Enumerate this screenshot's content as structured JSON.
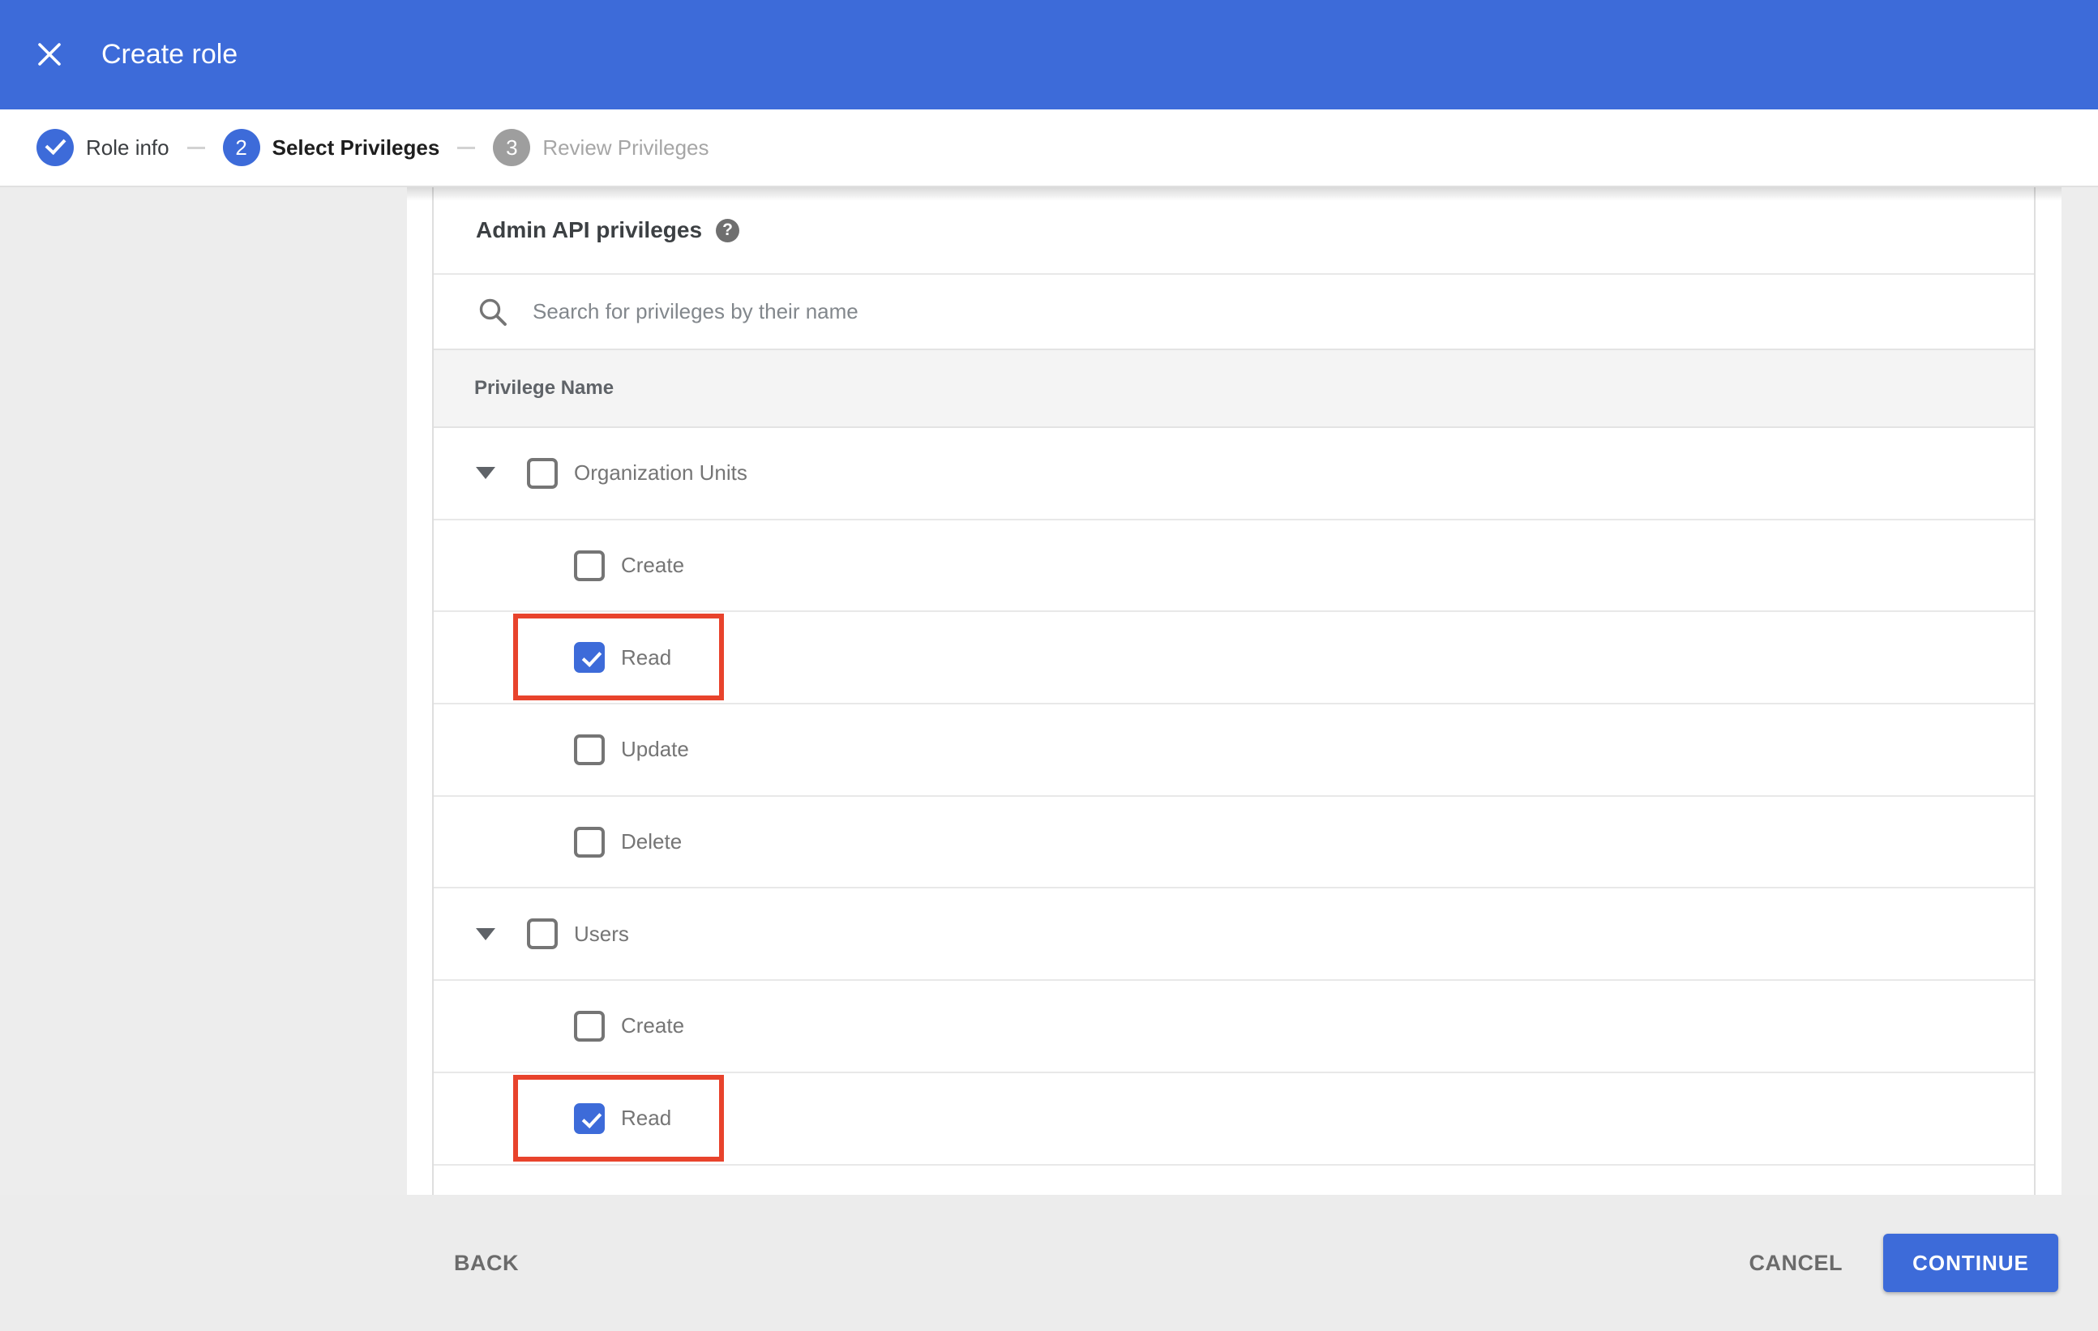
{
  "app": {
    "title": "Create role"
  },
  "colors": {
    "appbar_blue": "#3D6BD9",
    "accent_blue": "#3D6BD9",
    "annotation_red": "#E8432C",
    "inactive_step_gray": "#9E9E9E",
    "footer_gray": "#ECECEC",
    "side_gray": "#EDEDED",
    "header_row_gray": "#F4F4F4"
  },
  "icons": {
    "close": "close-x",
    "help_glyph": "?",
    "search": "magnifier",
    "expand": "triangle-down",
    "step_complete": "check"
  },
  "stepper": {
    "divider": "",
    "steps": [
      {
        "label": "Role info",
        "state": "completed"
      },
      {
        "number": "2",
        "label": "Select Privileges",
        "state": "active"
      },
      {
        "number": "3",
        "label": "Review Privileges",
        "state": "upcoming"
      }
    ]
  },
  "privileges": {
    "section_title": "Admin API privileges",
    "search_placeholder": "Search for privileges by their name",
    "column_header": "Privilege Name",
    "rows": [
      {
        "label": "Organization Units",
        "level": 0,
        "parent": true,
        "expanded": true,
        "checked": false,
        "highlighted": false
      },
      {
        "label": "Create",
        "level": 1,
        "parent": false,
        "checked": false,
        "highlighted": false
      },
      {
        "label": "Read",
        "level": 1,
        "parent": false,
        "checked": true,
        "highlighted": true
      },
      {
        "label": "Update",
        "level": 1,
        "parent": false,
        "checked": false,
        "highlighted": false
      },
      {
        "label": "Delete",
        "level": 1,
        "parent": false,
        "checked": false,
        "highlighted": false
      },
      {
        "label": "Users",
        "level": 0,
        "parent": true,
        "expanded": true,
        "checked": false,
        "highlighted": false
      },
      {
        "label": "Create",
        "level": 1,
        "parent": false,
        "checked": false,
        "highlighted": false
      },
      {
        "label": "Read",
        "level": 1,
        "parent": false,
        "checked": true,
        "highlighted": true
      }
    ]
  },
  "footer": {
    "back": "BACK",
    "cancel": "CANCEL",
    "continue": "CONTINUE"
  }
}
